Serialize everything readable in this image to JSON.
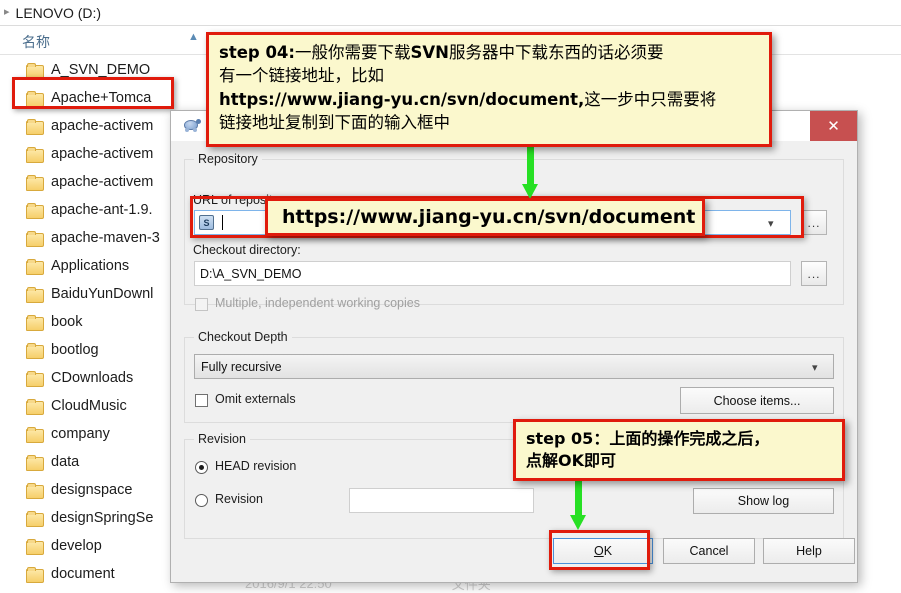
{
  "explorer": {
    "breadcrumb": "LENOVO (D:)",
    "crumb_arrow_icon": "chevron-right-icon",
    "column_header": "名称",
    "sort_arrow_icon": "sort-ascending-icon",
    "folders": [
      "A_SVN_DEMO",
      "Apache+Tomca",
      "apache-activem",
      "apache-activem",
      "apache-activem",
      "apache-ant-1.9.",
      "apache-maven-3",
      "Applications",
      "BaiduYunDownl",
      "book",
      "bootlog",
      "CDownloads",
      "CloudMusic",
      "company",
      "data",
      "designspace",
      "designSpringSe",
      "develop",
      "document"
    ],
    "background_faint": [
      "2016/9/1 22:50",
      "文件夹"
    ]
  },
  "dialog": {
    "title": "",
    "app_icon": "tortoise-svn-icon",
    "close_label": "✕",
    "repository": {
      "group_title": "Repository",
      "url_label": "URL of repository:",
      "url_value": "",
      "url_icon": "repository-icon",
      "browse_label": "...",
      "dropdown_icon": "chevron-down-icon",
      "checkout_dir_label": "Checkout directory:",
      "checkout_dir_value": "D:\\A_SVN_DEMO",
      "multiple_copies_label": "Multiple, independent working copies",
      "multiple_copies_checked": false
    },
    "checkout_depth": {
      "group_title": "Checkout Depth",
      "depth_value": "Fully recursive",
      "dropdown_icon": "chevron-down-icon",
      "omit_externals_label": "Omit externals",
      "omit_externals_checked": false,
      "choose_items_label": "Choose items..."
    },
    "revision": {
      "group_title": "Revision",
      "head_label": "HEAD revision",
      "head_selected": true,
      "revision_label": "Revision",
      "revision_selected": false,
      "revision_value": "",
      "show_log_label": "Show log"
    },
    "buttons": {
      "ok_prefix": "O",
      "ok_suffix": "K",
      "cancel_label": "Cancel",
      "help_label": "Help"
    }
  },
  "annotations": {
    "step04": {
      "line1_bold": "step 04:",
      "line1_rest": "一般你需要下载",
      "line1_bold2": "SVN",
      "line1_rest2": "服务器中下载东西的话必须要",
      "line2": "有一个链接地址，比如",
      "line3_bold": "https://www.jiang-yu.cn/svn/document,",
      "line3_rest": "这一步中只需要将",
      "line4": "链接地址复制到下面的输入框中"
    },
    "url_callout": "https://www.jiang-yu.cn/svn/document",
    "step05": {
      "line1": "step 05：上面的操作完成之后，",
      "line2": "点解OK即可"
    },
    "highlight_color": "#e01b0c",
    "note_bg_color": "#fbf8cd",
    "arrow_color": "#27e024"
  }
}
